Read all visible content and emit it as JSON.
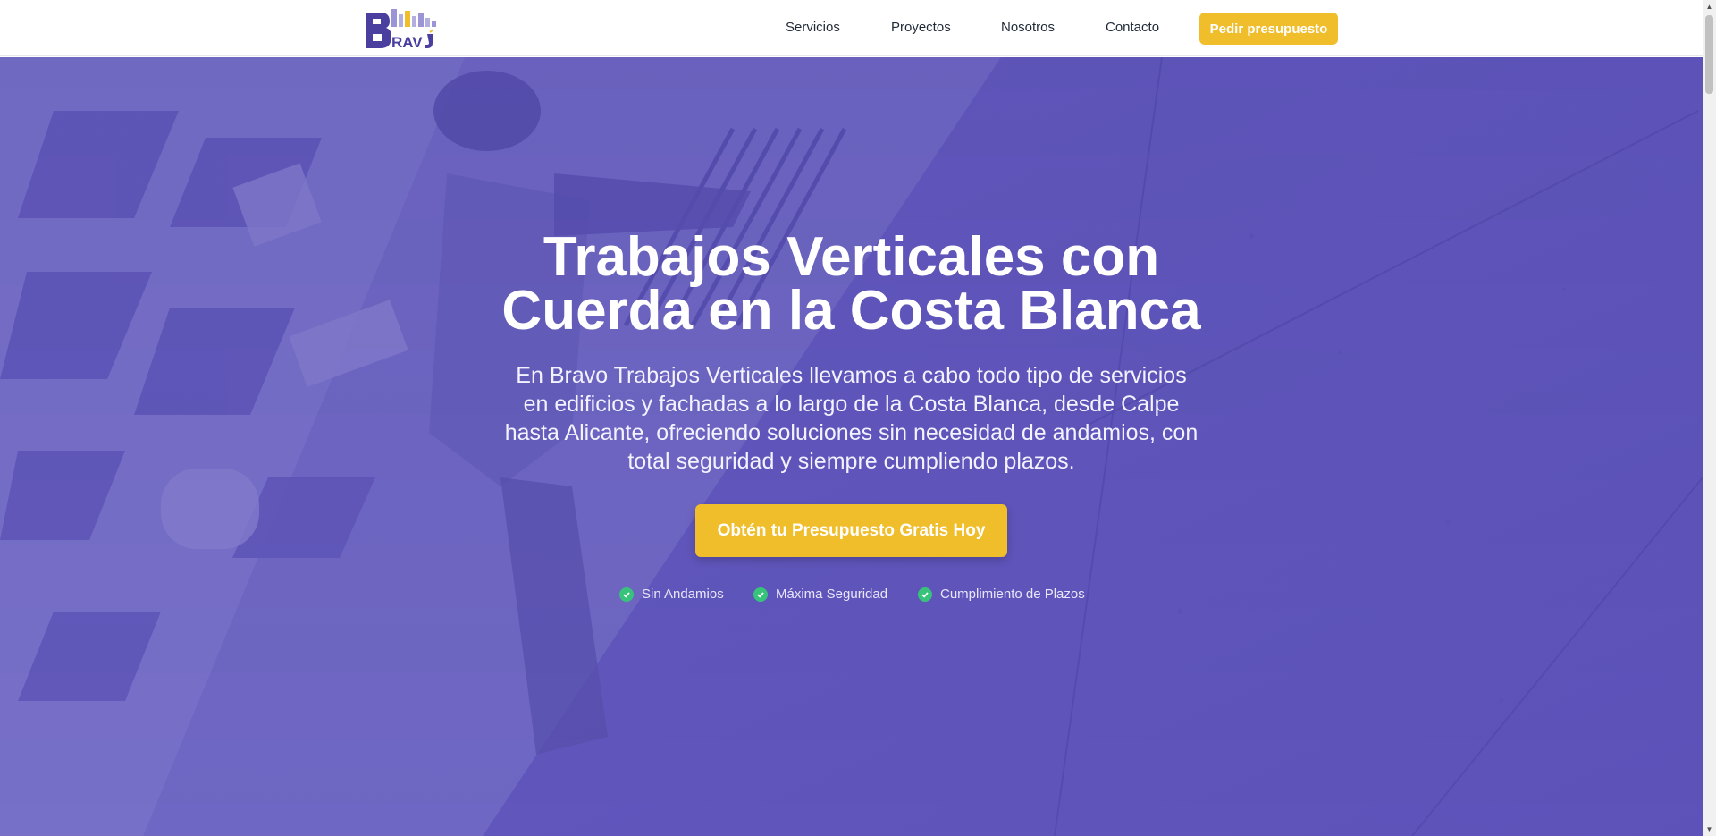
{
  "header": {
    "logo_text": "BRAVO",
    "nav": [
      {
        "label": "Servicios"
      },
      {
        "label": "Proyectos"
      },
      {
        "label": "Nosotros"
      },
      {
        "label": "Contacto"
      }
    ],
    "cta_label": "Pedir presupuesto"
  },
  "hero": {
    "title_line1": "Trabajos Verticales con",
    "title_line2": "Cuerda en la Costa Blanca",
    "subtitle": "En Bravo Trabajos Verticales llevamos a cabo todo tipo de servicios en edificios y fachadas a lo largo de la Costa Blanca, desde Calpe hasta Alicante, ofreciendo soluciones sin necesidad de andamios, con total seguridad y siempre cumpliendo plazos.",
    "cta_label": "Obtén tu Presupuesto Gratis Hoy",
    "features": [
      {
        "label": "Sin Andamios"
      },
      {
        "label": "Máxima Seguridad"
      },
      {
        "label": "Cumplimiento de Plazos"
      }
    ]
  },
  "colors": {
    "accent": "#f0bd2b",
    "hero_purple": "#5d53b6",
    "check_green": "#37c47a",
    "logo_purple": "#4a3f9f"
  },
  "icons": {
    "feature_icon": "check-circle-icon",
    "scroll_up": "chevron-up-icon",
    "scroll_down": "chevron-down-icon"
  }
}
